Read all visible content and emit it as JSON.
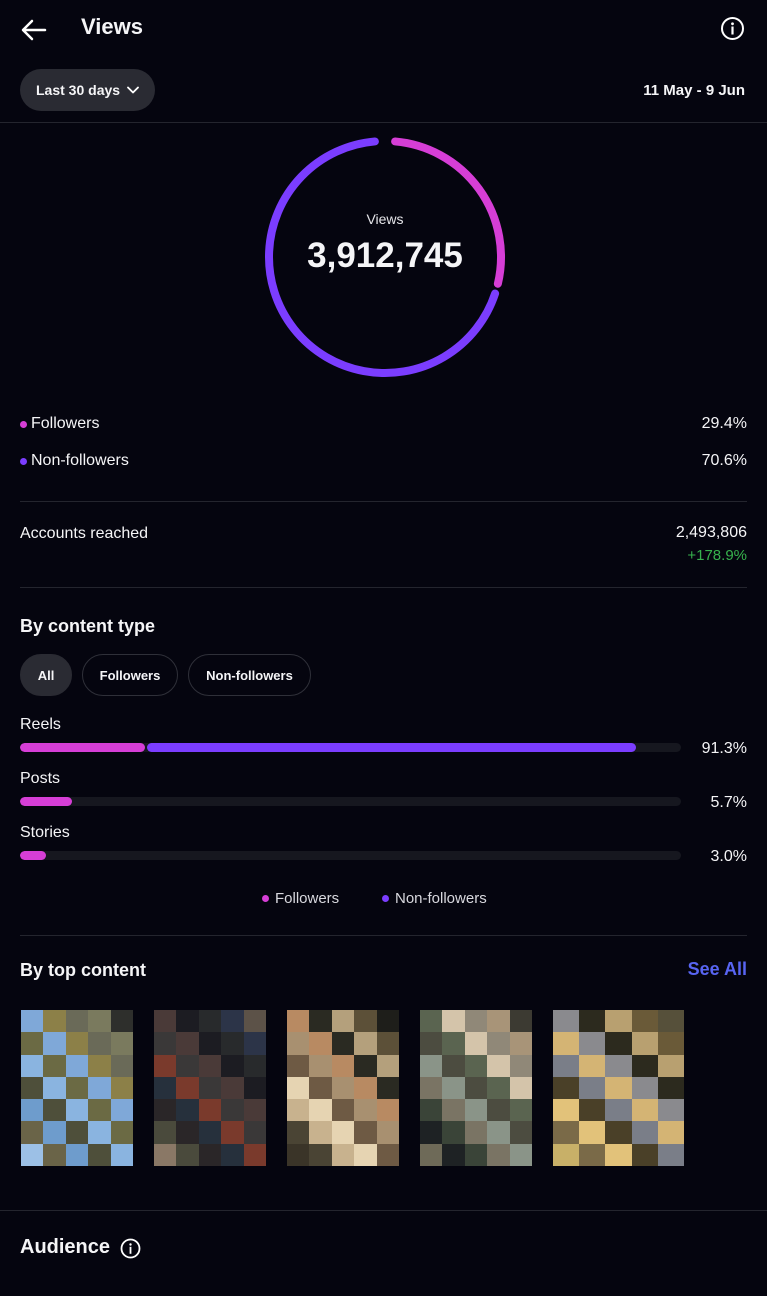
{
  "header": {
    "title": "Views",
    "back_icon": "back-arrow-icon",
    "info_icon": "info-icon"
  },
  "period": {
    "selector_label": "Last 30 days",
    "date_range": "11 May - 9 Jun"
  },
  "summary": {
    "center_label": "Views",
    "total": "3,912,745",
    "breakdown": [
      {
        "label": "Followers",
        "percent": "29.4%",
        "fraction": 0.294,
        "color": "#d63ed6"
      },
      {
        "label": "Non-followers",
        "percent": "70.6%",
        "fraction": 0.706,
        "color": "#7b3dff"
      }
    ]
  },
  "reach": {
    "label": "Accounts reached",
    "value": "2,493,806",
    "change": "+178.9%",
    "change_color": "#37b24d"
  },
  "content_type": {
    "title": "By content type",
    "filters": [
      {
        "label": "All",
        "active": true
      },
      {
        "label": "Followers",
        "active": false
      },
      {
        "label": "Non-followers",
        "active": false
      }
    ],
    "rows": [
      {
        "label": "Reels",
        "percent": "91.3%",
        "followers_fraction": 0.189,
        "nonfollowers_fraction": 0.74
      },
      {
        "label": "Posts",
        "percent": "5.7%",
        "followers_fraction": 0.078,
        "nonfollowers_fraction": 0
      },
      {
        "label": "Stories",
        "percent": "3.0%",
        "followers_fraction": 0.04,
        "nonfollowers_fraction": 0
      }
    ],
    "legend": [
      {
        "label": "Followers",
        "color": "#d63ed6"
      },
      {
        "label": "Non-followers",
        "color": "#7b3dff"
      }
    ]
  },
  "top_content": {
    "title": "By top content",
    "see_all": "See All"
  },
  "audience": {
    "title": "Audience",
    "info_icon": "info-icon"
  }
}
